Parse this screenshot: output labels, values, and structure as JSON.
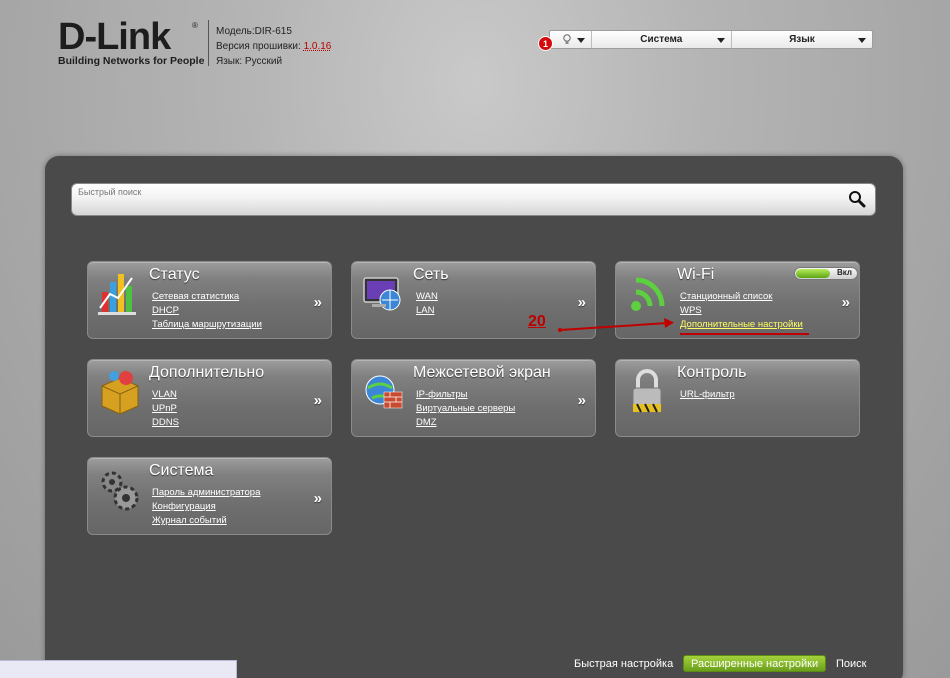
{
  "header": {
    "logo_text": "D-Link",
    "logo_reg": "®",
    "logo_tagline": "Building Networks for People",
    "model": "Модель:DIR-615",
    "firmware_label": "Версия прошивки: ",
    "firmware_version": "1.0.16",
    "language_info": "Язык: Русский"
  },
  "topbar": {
    "notification_count": "1",
    "system_menu": "Система",
    "language_menu": "Язык"
  },
  "search": {
    "placeholder": "Быстрый поиск"
  },
  "tiles": {
    "status": {
      "title": "Статус",
      "links": [
        "Сетевая статистика",
        "DHCP",
        "Таблица маршрутизации"
      ]
    },
    "network": {
      "title": "Сеть",
      "links": [
        "WAN",
        "LAN"
      ]
    },
    "wifi": {
      "title": "Wi-Fi",
      "toggle_label": "Вкл",
      "links": [
        "Станционный список",
        "WPS",
        "Дополнительные настройки"
      ]
    },
    "advanced": {
      "title": "Дополнительно",
      "links": [
        "VLAN",
        "UPnP",
        "DDNS"
      ]
    },
    "firewall": {
      "title": "Межсетевой экран",
      "links": [
        "IP-фильтры",
        "Виртуальные серверы",
        "DMZ"
      ]
    },
    "control": {
      "title": "Контроль",
      "links": [
        "URL-фильтр"
      ]
    },
    "system": {
      "title": "Система",
      "links": [
        "Пароль администратора",
        "Конфигурация",
        "Журнал событий"
      ]
    },
    "chevron": "»"
  },
  "annotation": {
    "number": "20",
    "color": "#c00000"
  },
  "footer": {
    "quick_setup": "Быстрая настройка",
    "advanced_settings": "Расширенные настройки",
    "search": "Поиск"
  }
}
